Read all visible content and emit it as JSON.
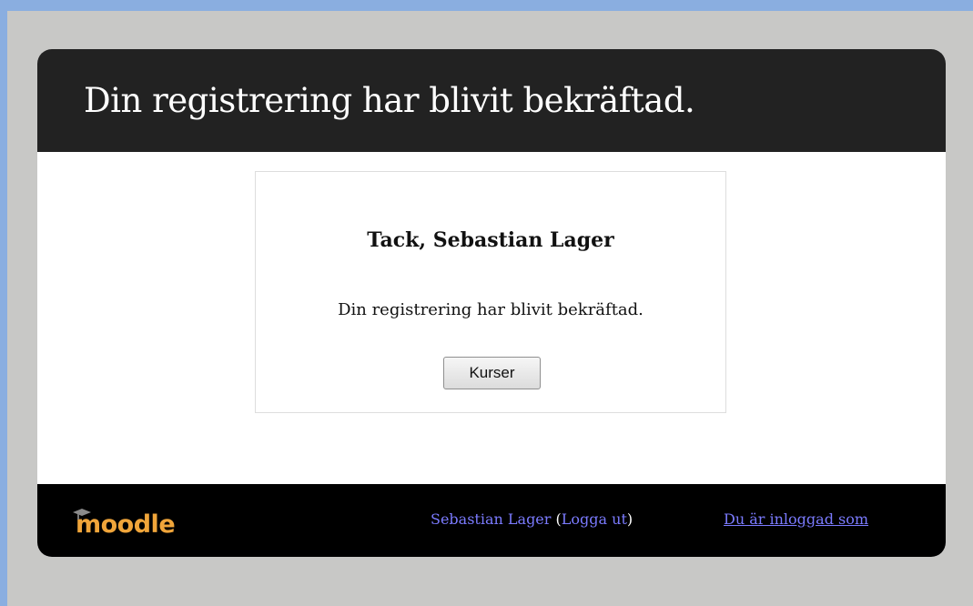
{
  "header": {
    "title": "Din registrering har blivit bekräftad."
  },
  "confirmation": {
    "heading": "Tack, Sebastian Lager",
    "message": "Din registrering har blivit bekräftad.",
    "button_label": "Kurser"
  },
  "footer": {
    "logo_text": "moodle",
    "user_name": "Sebastian Lager",
    "logout_open": "(",
    "logout_label": "Logga ut",
    "logout_close": ")",
    "logged_in_as": "Du är inloggad som"
  },
  "colors": {
    "header_bg": "#222222",
    "footer_bg": "#000000",
    "link": "#7b7bff",
    "logo": "#f0a53a",
    "page_bg": "#c8c8c6"
  }
}
